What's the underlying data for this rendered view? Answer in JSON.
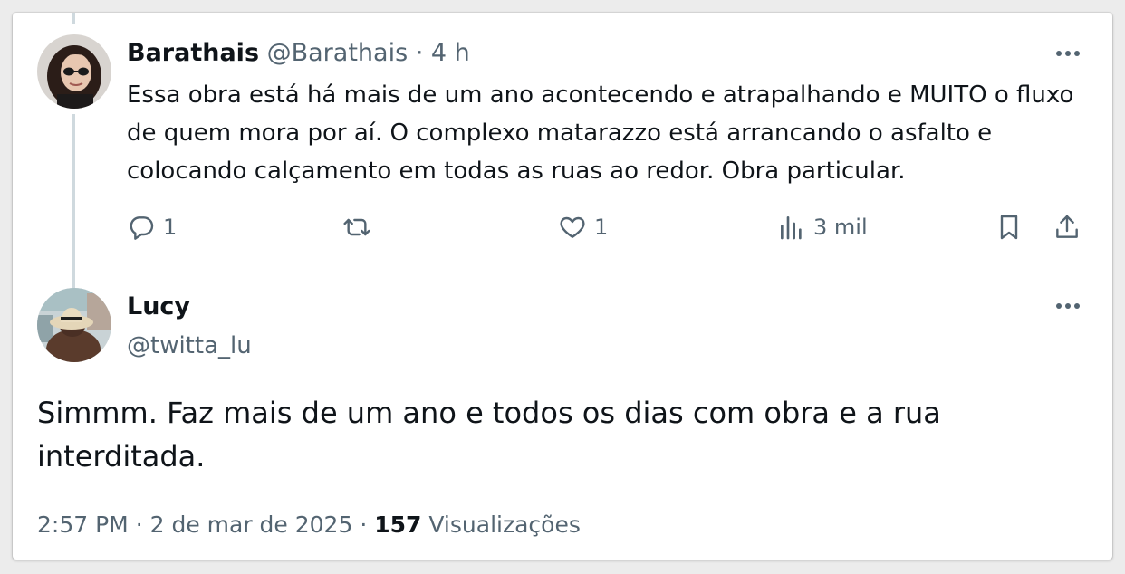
{
  "tweet_parent": {
    "display_name": "Barathais",
    "handle": "@Barathais",
    "separator": "·",
    "time_ago": "4 h",
    "text": "Essa obra está há mais de um ano acontecendo e atrapalhando e MUITO o fluxo de quem mora por aí. O complexo matarazzo está arrancando o asfalto e colocando calçamento em todas as ruas ao redor. Obra particular.",
    "replies": "1",
    "retweets": "",
    "likes": "1",
    "views": "3 mil",
    "icons": {
      "more": "more-horizontal-icon",
      "reply": "reply-icon",
      "retweet": "retweet-icon",
      "like": "heart-icon",
      "views": "analytics-icon",
      "bookmark": "bookmark-icon",
      "share": "share-icon"
    }
  },
  "tweet_main": {
    "display_name": "Lucy",
    "handle": "@twitta_lu",
    "text": "Simmm. Faz mais de um ano e todos os dias com obra e a rua interditada.",
    "time": "2:57 PM",
    "separator": "·",
    "date": "2 de mar de 2025",
    "view_count": "157",
    "views_label": "Visualizações"
  },
  "colors": {
    "text_primary": "#0f1419",
    "text_secondary": "#536471",
    "thread_line": "#cfd9de",
    "background": "#ffffff"
  }
}
